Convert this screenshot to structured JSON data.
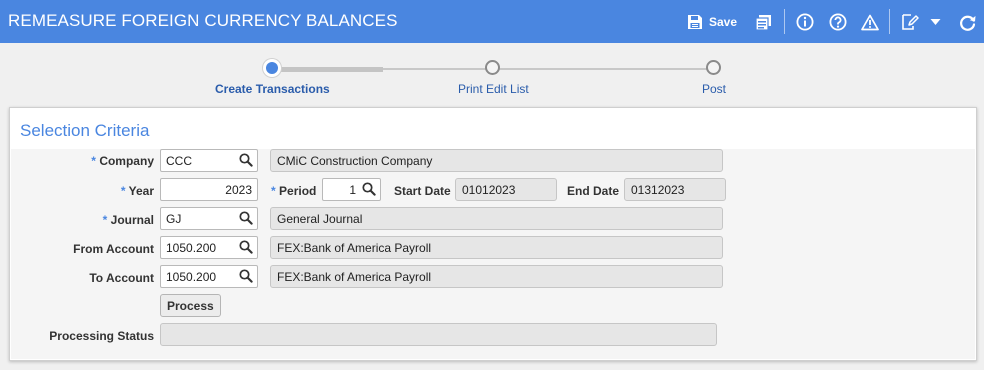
{
  "header": {
    "title": "REMEASURE FOREIGN CURRENCY BALANCES",
    "save_label": "Save"
  },
  "stepper": {
    "steps": [
      {
        "label": "Create Transactions",
        "state": "active"
      },
      {
        "label": "Print Edit List",
        "state": "pending"
      },
      {
        "label": "Post",
        "state": "pending"
      }
    ]
  },
  "selection": {
    "title": "Selection Criteria",
    "company": {
      "label": "Company",
      "value": "CCC",
      "name": "CMiC Construction Company"
    },
    "year": {
      "label": "Year",
      "value": "2023"
    },
    "period": {
      "label": "Period",
      "value": "1"
    },
    "start_date": {
      "label": "Start Date",
      "value": "01012023"
    },
    "end_date": {
      "label": "End Date",
      "value": "01312023"
    },
    "journal": {
      "label": "Journal",
      "value": "GJ",
      "name": "General Journal"
    },
    "from_account": {
      "label": "From Account",
      "value": "1050.200",
      "name": "FEX:Bank of America Payroll"
    },
    "to_account": {
      "label": "To Account",
      "value": "1050.200",
      "name": "FEX:Bank of America Payroll"
    },
    "process_label": "Process",
    "processing_status": {
      "label": "Processing Status",
      "value": ""
    }
  },
  "colors": {
    "accent": "#4a86e0",
    "header_bg": "#4a86e0",
    "step_label": "#2a5cab"
  },
  "icons": [
    "save-icon",
    "report-icon",
    "info-icon",
    "help-icon",
    "warning-icon",
    "edit-icon",
    "dropdown-icon",
    "refresh-icon",
    "search-icon"
  ]
}
